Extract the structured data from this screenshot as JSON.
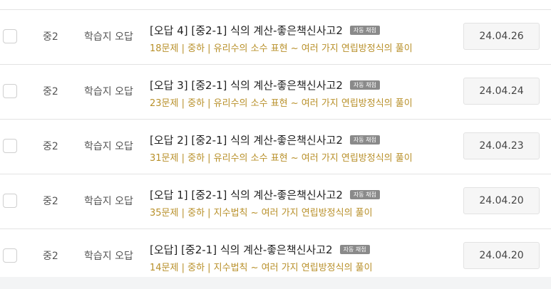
{
  "rows": [
    {
      "grade": "중2",
      "type": "학습지 오답",
      "title": "[오답 4] [중2-1] 식의 계산-좋은책신사고2",
      "badge": "자동 채점",
      "meta": "18문제 | 중하 | 유리수의 소수 표현 ~ 여러 가지 연립방정식의 풀이",
      "date": "24.04.26"
    },
    {
      "grade": "중2",
      "type": "학습지 오답",
      "title": "[오답 3] [중2-1] 식의 계산-좋은책신사고2",
      "badge": "자동 채점",
      "meta": "23문제 | 중하 | 유리수의 소수 표현 ~ 여러 가지 연립방정식의 풀이",
      "date": "24.04.24"
    },
    {
      "grade": "중2",
      "type": "학습지 오답",
      "title": "[오답 2] [중2-1] 식의 계산-좋은책신사고2",
      "badge": "자동 채점",
      "meta": "31문제 | 중하 | 유리수의 소수 표현 ~ 여러 가지 연립방정식의 풀이",
      "date": "24.04.23"
    },
    {
      "grade": "중2",
      "type": "학습지 오답",
      "title": "[오답 1] [중2-1] 식의 계산-좋은책신사고2",
      "badge": "자동 채점",
      "meta": "35문제 | 중하 | 지수법칙 ~ 여러 가지 연립방정식의 풀이",
      "date": "24.04.20"
    },
    {
      "grade": "중2",
      "type": "학습지 오답",
      "title": "[오답] [중2-1] 식의 계산-좋은책신사고2",
      "badge": "자동 채점",
      "meta": "14문제 | 중하 | 지수법칙 ~ 여러 가지 연립방정식의 풀이",
      "date": "24.04.20"
    }
  ],
  "colors": {
    "meta_text": "#b8902a",
    "badge_bg": "#8a8a8a",
    "divider": "#e3e3e3"
  }
}
